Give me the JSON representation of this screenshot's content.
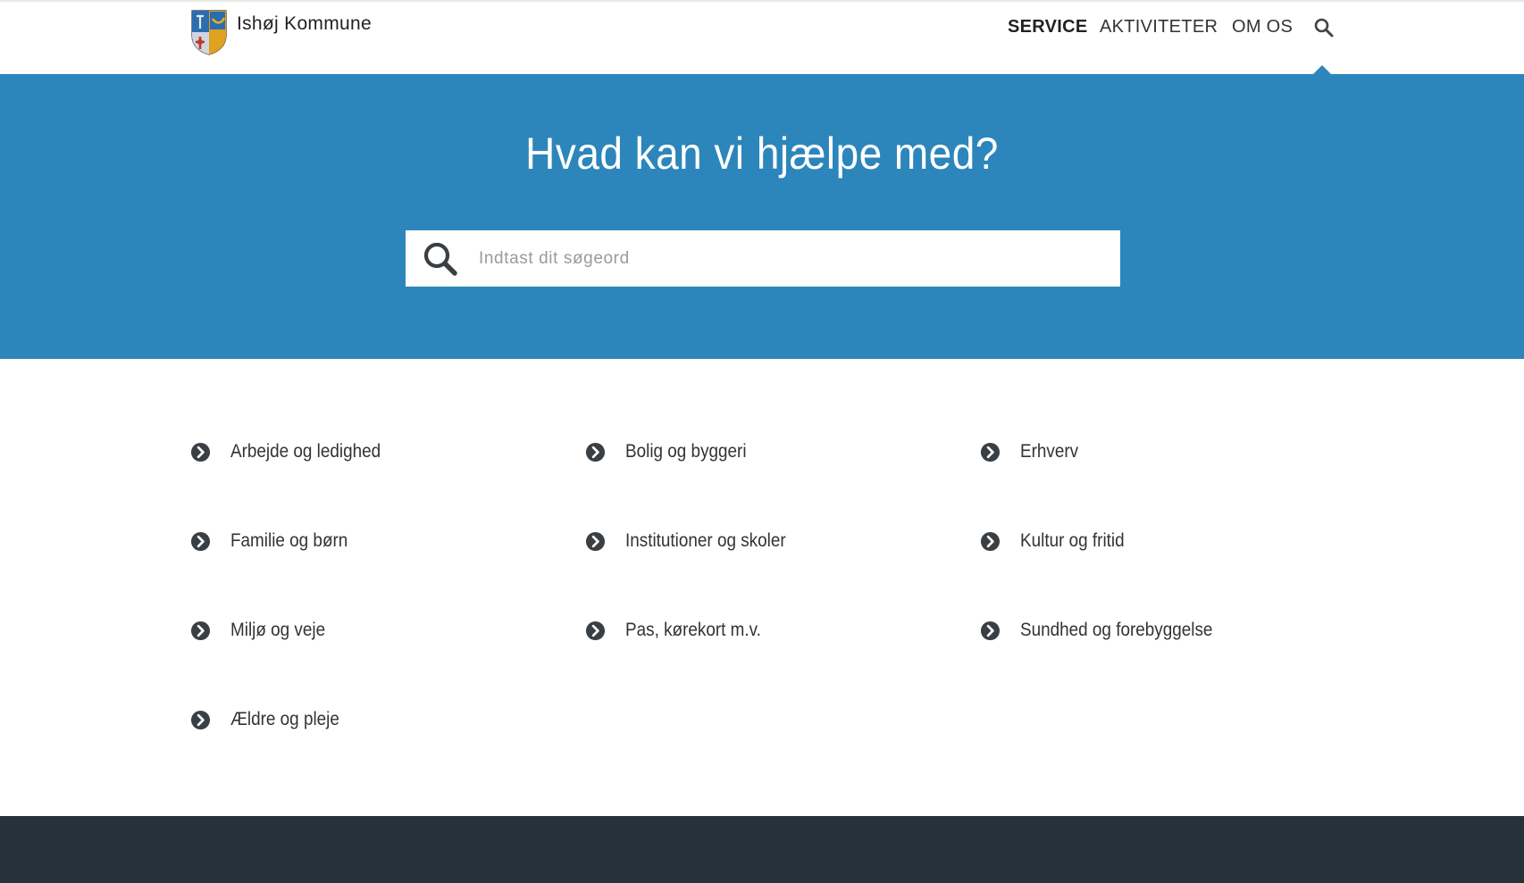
{
  "header": {
    "logo_text": "Ishøj Kommune",
    "nav": [
      {
        "label": "SERVICE",
        "active": true
      },
      {
        "label": "AKTIVITETER",
        "active": false
      },
      {
        "label": "OM OS",
        "active": false
      }
    ],
    "search_icon": "search-icon"
  },
  "hero": {
    "title": "Hvad kan vi hjælpe med?",
    "search_placeholder": "Indtast dit søgeord",
    "search_value": ""
  },
  "categories": {
    "icon": "chevron-circle-right-icon",
    "items": [
      {
        "label": "Arbejde og ledighed"
      },
      {
        "label": "Bolig og byggeri"
      },
      {
        "label": "Erhverv"
      },
      {
        "label": "Familie og børn"
      },
      {
        "label": "Institutioner og skoler"
      },
      {
        "label": "Kultur og fritid"
      },
      {
        "label": "Miljø og veje"
      },
      {
        "label": "Pas, kørekort m.v."
      },
      {
        "label": "Sundhed og forebyggelse"
      },
      {
        "label": "Ældre og pleje"
      }
    ]
  },
  "colors": {
    "hero_background": "#2c86bb",
    "footer_background": "#26323b",
    "text": "#333333",
    "icon": "#3a3f44"
  }
}
